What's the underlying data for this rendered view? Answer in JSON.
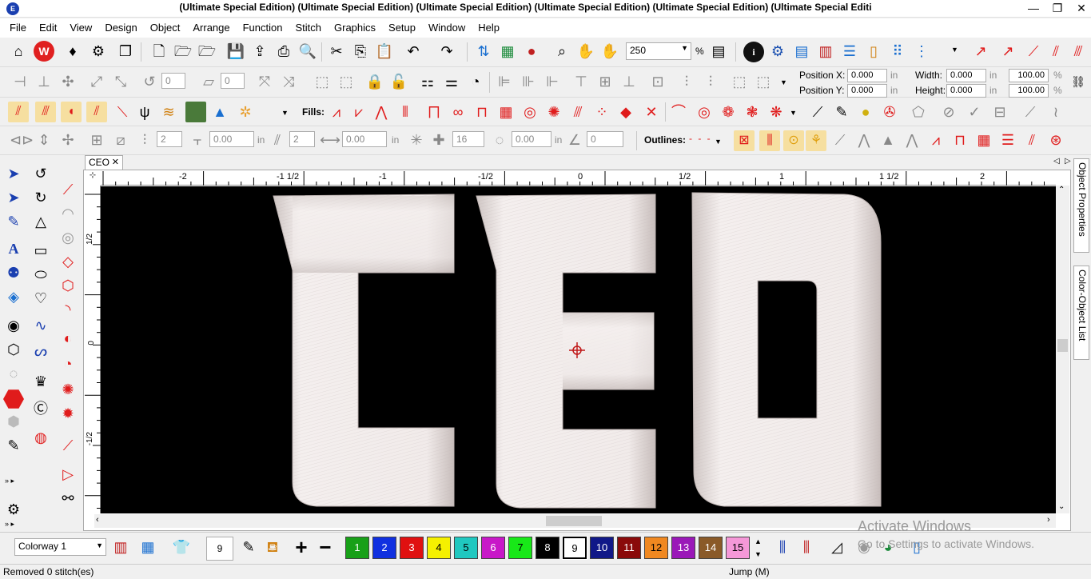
{
  "window": {
    "title": "(Ultimate Special Edition) (Ultimate Special Edition) (Ultimate Special Edition) (Ultimate Special Edition) (Ultimate Special Edition) (Ultimate Special Editi",
    "minimize_glyph": "—",
    "restore_glyph": "❐",
    "close_glyph": "✕"
  },
  "menu": [
    "File",
    "Edit",
    "View",
    "Design",
    "Object",
    "Arrange",
    "Function",
    "Stitch",
    "Graphics",
    "Setup",
    "Window",
    "Help"
  ],
  "toolbar1": {
    "zoom_value": "250",
    "zoom_unit": "%"
  },
  "toolbar2": {
    "rotate_value": "0",
    "slant_value": "0",
    "position_x_label": "Position X:",
    "position_x": "0.000",
    "position_y_label": "Position Y:",
    "position_y": "0.000",
    "unit_in": "in",
    "width_label": "Width:",
    "width": "0.000",
    "height_label": "Height:",
    "height": "0.000",
    "width_pct": "100.00",
    "height_pct": "100.00",
    "pct": "%"
  },
  "toolbar3": {
    "fills_label": "Fills:"
  },
  "toolbar4": {
    "count1": "2",
    "spacing1": "0.00",
    "unit1": "in",
    "count2": "2",
    "spacing2": "0.00",
    "unit2": "in",
    "points": "16",
    "offset": "0.00",
    "unit3": "in",
    "angle": "0",
    "outlines_label": "Outlines:"
  },
  "document": {
    "tab_label": "CEO",
    "tab_close": "✕",
    "design_text": "CEO"
  },
  "ruler": {
    "top_ticks": [
      "-2",
      "-1 1/2",
      "-1",
      "-1/2",
      "0",
      "1/2",
      "1",
      "1 1/2",
      "2"
    ],
    "left_ticks": [
      "1/2",
      "0",
      "-1/2"
    ]
  },
  "right_dock": {
    "object_properties": "Object Properties",
    "color_object_list": "Color-Object List"
  },
  "bottom": {
    "colorway": "Colorway 1",
    "current_color": "9",
    "swatches": [
      {
        "label": "1",
        "color": "#18a018",
        "text": "#ffffff"
      },
      {
        "label": "2",
        "color": "#1030e0",
        "text": "#ffffff"
      },
      {
        "label": "3",
        "color": "#e01010",
        "text": "#ffffff"
      },
      {
        "label": "4",
        "color": "#f5f000",
        "text": "#000000"
      },
      {
        "label": "5",
        "color": "#20c8c0",
        "text": "#000000"
      },
      {
        "label": "6",
        "color": "#c818c8",
        "text": "#ffffff"
      },
      {
        "label": "7",
        "color": "#18e818",
        "text": "#000000"
      },
      {
        "label": "8",
        "color": "#000000",
        "text": "#ffffff"
      },
      {
        "label": "9",
        "color": "#ffffff",
        "text": "#000000"
      },
      {
        "label": "10",
        "color": "#101888",
        "text": "#ffffff"
      },
      {
        "label": "11",
        "color": "#8a0a0a",
        "text": "#ffffff"
      },
      {
        "label": "12",
        "color": "#f08820",
        "text": "#000000"
      },
      {
        "label": "13",
        "color": "#9a18b8",
        "text": "#ffffff"
      },
      {
        "label": "14",
        "color": "#8a5a28",
        "text": "#ffffff"
      },
      {
        "label": "15",
        "color": "#f598d8",
        "text": "#000000"
      }
    ]
  },
  "status": {
    "left": "Removed 0 stitch(es)",
    "center": "Jump (M)"
  },
  "watermark": {
    "line1": "Activate Windows",
    "line2": "Go to Settings to activate Windows."
  },
  "colors": {
    "accent_red": "#e01b1b",
    "thread_white": "#ece6e4"
  }
}
